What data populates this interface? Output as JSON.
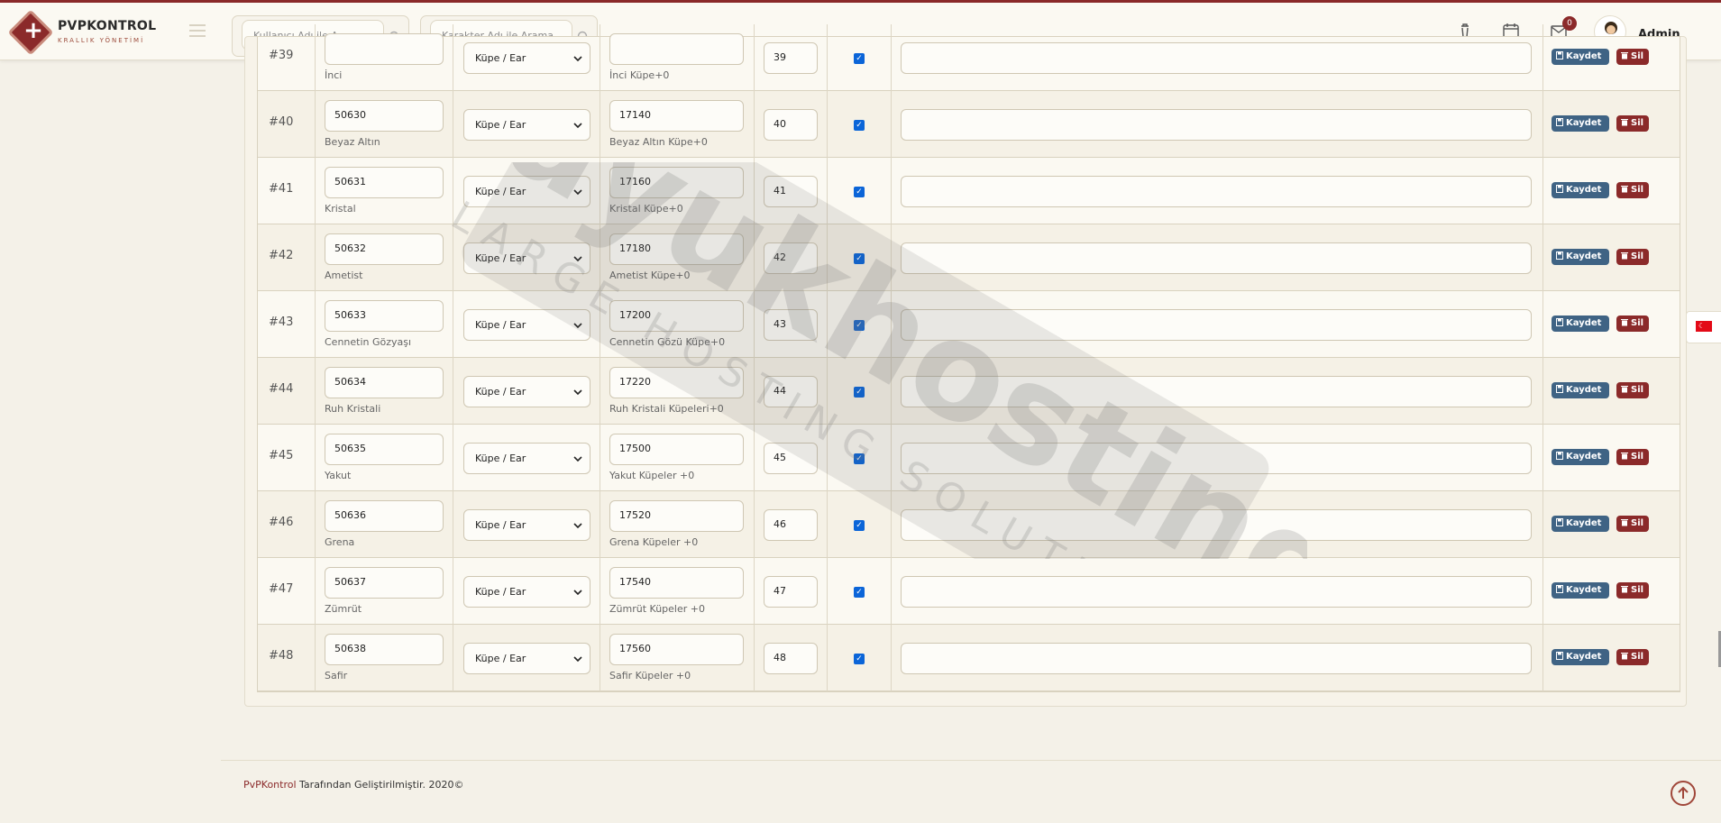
{
  "brand": {
    "name": "PVPKONTROL",
    "subtitle": "KRALLIK YÖNETİMİ"
  },
  "header": {
    "search_user_placeholder": "Kullanıcı Adı ile Arama",
    "search_char_placeholder": "Karakter Adı ile Arama",
    "messages_badge": "0",
    "admin_name": "Admin"
  },
  "rows": [
    {
      "id": "#39",
      "item_code": "",
      "item_name": "İnci",
      "type": "Küpe / Ear",
      "upgrade_code": "",
      "upgrade_name": "İnci Küpe+0",
      "order": "39",
      "checked": true,
      "note": ""
    },
    {
      "id": "#40",
      "item_code": "50630",
      "item_name": "Beyaz Altın",
      "type": "Küpe / Ear",
      "upgrade_code": "17140",
      "upgrade_name": "Beyaz Altın Küpe+0",
      "order": "40",
      "checked": true,
      "note": ""
    },
    {
      "id": "#41",
      "item_code": "50631",
      "item_name": "Kristal",
      "type": "Küpe / Ear",
      "upgrade_code": "17160",
      "upgrade_name": "Kristal Küpe+0",
      "order": "41",
      "checked": true,
      "note": ""
    },
    {
      "id": "#42",
      "item_code": "50632",
      "item_name": "Ametist",
      "type": "Küpe / Ear",
      "upgrade_code": "17180",
      "upgrade_name": "Ametist Küpe+0",
      "order": "42",
      "checked": true,
      "note": ""
    },
    {
      "id": "#43",
      "item_code": "50633",
      "item_name": "Cennetin Gözyaşı",
      "type": "Küpe / Ear",
      "upgrade_code": "17200",
      "upgrade_name": "Cennetin Gözü Küpe+0",
      "order": "43",
      "checked": true,
      "note": ""
    },
    {
      "id": "#44",
      "item_code": "50634",
      "item_name": "Ruh Kristali",
      "type": "Küpe / Ear",
      "upgrade_code": "17220",
      "upgrade_name": "Ruh Kristali Küpeleri+0",
      "order": "44",
      "checked": true,
      "note": ""
    },
    {
      "id": "#45",
      "item_code": "50635",
      "item_name": "Yakut",
      "type": "Küpe / Ear",
      "upgrade_code": "17500",
      "upgrade_name": "Yakut Küpeler +0",
      "order": "45",
      "checked": true,
      "note": ""
    },
    {
      "id": "#46",
      "item_code": "50636",
      "item_name": "Grena",
      "type": "Küpe / Ear",
      "upgrade_code": "17520",
      "upgrade_name": "Grena Küpeler +0",
      "order": "46",
      "checked": true,
      "note": ""
    },
    {
      "id": "#47",
      "item_code": "50637",
      "item_name": "Zümrüt",
      "type": "Küpe / Ear",
      "upgrade_code": "17540",
      "upgrade_name": "Zümrüt Küpeler +0",
      "order": "47",
      "checked": true,
      "note": ""
    },
    {
      "id": "#48",
      "item_code": "50638",
      "item_name": "Safir",
      "type": "Küpe / Ear",
      "upgrade_code": "17560",
      "upgrade_name": "Safir Küpeler +0",
      "order": "48",
      "checked": true,
      "note": ""
    }
  ],
  "actions": {
    "save_label": "Kaydet",
    "delete_label": "Sil"
  },
  "watermark": {
    "brand": "buyukhosting",
    "tagline": "LARGE HOSTING SOLUTIONS"
  },
  "footer": {
    "brand_link": "PvPKontrol",
    "text": " Tarafından Geliştirilmiştir. 2020©"
  },
  "colors": {
    "accent": "#8b2a2a",
    "save": "#3f6384",
    "delete": "#8b2a2a",
    "checkbox": "#0b65d8"
  },
  "icons": {
    "header": [
      "trash-icon",
      "calendar-icon",
      "mail-icon"
    ],
    "side": "turkey-flag-icon",
    "footer": "arrow-up-circle-icon"
  }
}
